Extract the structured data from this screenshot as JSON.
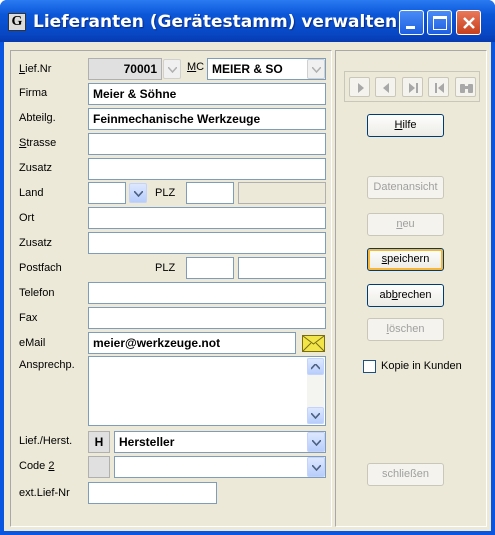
{
  "window": {
    "app_icon_letter": "G",
    "title": "Lieferanten (Gerätestamm) verwalten"
  },
  "form": {
    "lief_nr": {
      "label_underlined": "L",
      "label_rest": "ief.Nr",
      "value": "70001"
    },
    "mc": {
      "label_underlined": "M",
      "label_rest": "C",
      "value": "MEIER & SO"
    },
    "firma": {
      "label": "Firma",
      "value": "Meier & Söhne"
    },
    "abteilg": {
      "label": "Abteilg.",
      "value": "Feinmechanische Werkzeuge"
    },
    "strasse": {
      "label_underlined": "S",
      "label_rest": "trasse",
      "value": ""
    },
    "zusatz1": {
      "label": "Zusatz",
      "value": ""
    },
    "land": {
      "label": "Land",
      "value": ""
    },
    "plz1": {
      "label": "PLZ",
      "value": "",
      "city": ""
    },
    "ort": {
      "label": "Ort",
      "value": ""
    },
    "zusatz2": {
      "label": "Zusatz",
      "value": ""
    },
    "postfach": {
      "label": "Postfach"
    },
    "plz2": {
      "label": "PLZ",
      "value": "",
      "city": ""
    },
    "telefon": {
      "label": "Telefon",
      "value": ""
    },
    "fax": {
      "label": "Fax",
      "value": ""
    },
    "email": {
      "label": "eMail",
      "value": "meier@werkzeuge.not"
    },
    "ansprechp": {
      "label": "Ansprechp.",
      "value": ""
    },
    "lief_herst": {
      "label": "Lief./Herst.",
      "code": "H",
      "value": "Hersteller"
    },
    "code2": {
      "label_pre": "Code ",
      "label_underlined": "2",
      "code": "",
      "value": ""
    },
    "ext_lief_nr": {
      "label": "ext.Lief-Nr",
      "value": ""
    }
  },
  "side": {
    "hilfe": {
      "underlined": "H",
      "rest": "ilfe"
    },
    "datenansicht": "Datenansicht",
    "neu": {
      "underlined": "n",
      "rest": "eu"
    },
    "speichern": {
      "underlined": "s",
      "rest": "peichern"
    },
    "abbrechen": {
      "pre": "ab",
      "underlined": "b",
      "rest": "rechen"
    },
    "loeschen": {
      "underlined": "l",
      "rest": "öschen"
    },
    "kopie_label": "Kopie in Kunden",
    "schliessen": "schließen"
  },
  "icons": {
    "app": "app-g-icon",
    "minimize": "minimize-icon",
    "maximize": "maximize-icon",
    "close": "close-icon",
    "nav_next": "nav-next-icon",
    "nav_prev": "nav-prev-icon",
    "nav_last": "nav-last-icon",
    "nav_first": "nav-first-icon",
    "nav_search": "binoculars-icon",
    "mail": "envelope-icon"
  },
  "colors": {
    "titlebar": "#0b56d8",
    "client_bg": "#ece9d8",
    "focus_border": "#f8b636",
    "mail_icon": "#f2e54a"
  }
}
